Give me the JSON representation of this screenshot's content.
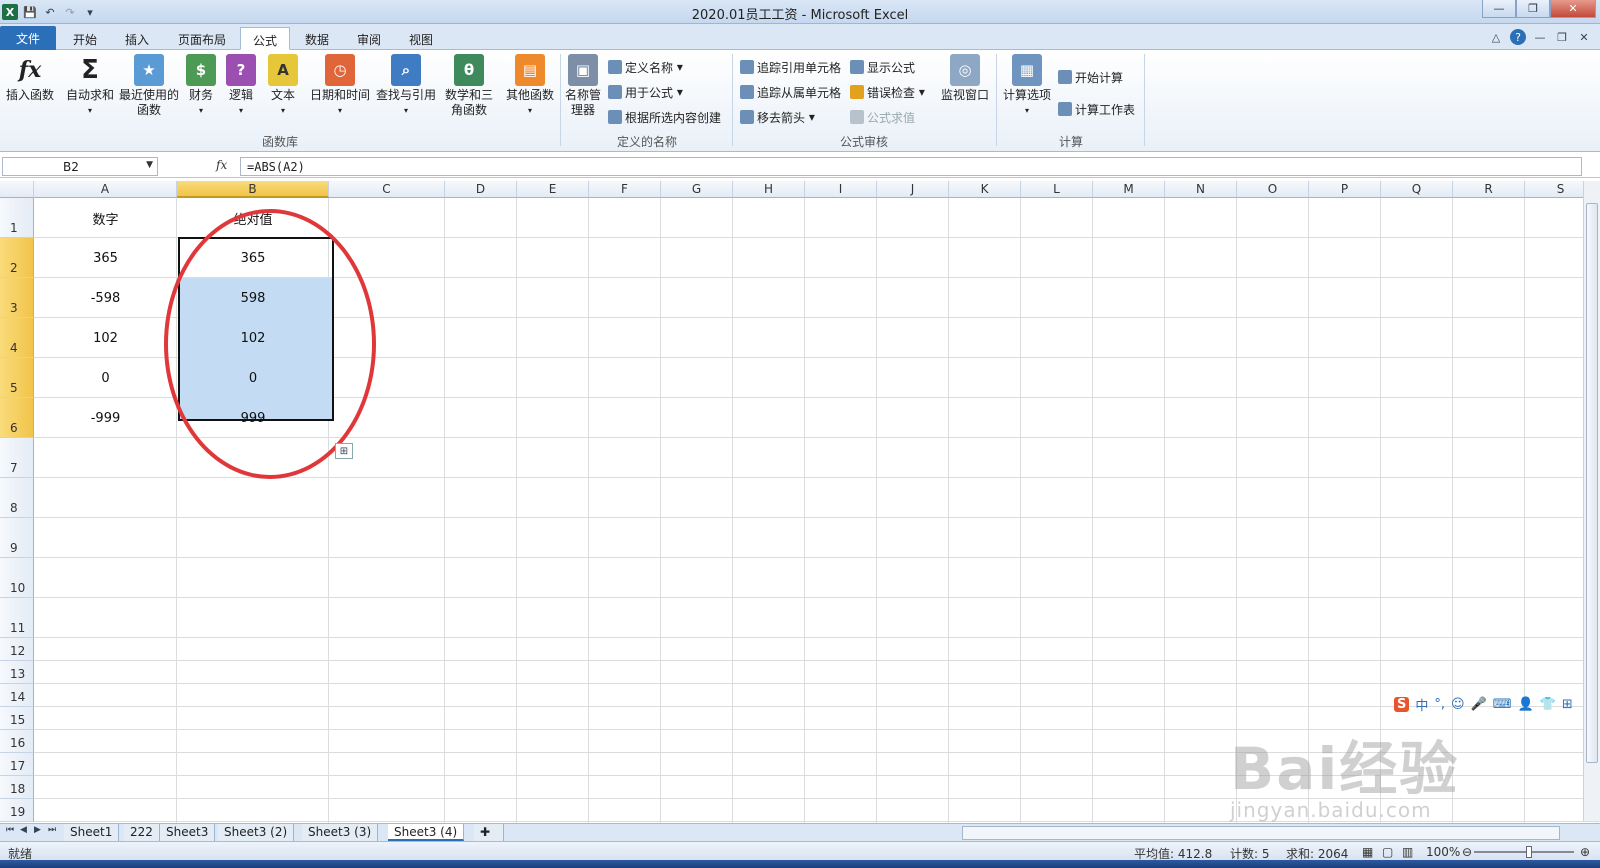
{
  "window": {
    "title": "2020.01员工工资 - Microsoft Excel"
  },
  "tabs": [
    "文件",
    "开始",
    "插入",
    "页面布局",
    "公式",
    "数据",
    "审阅",
    "视图"
  ],
  "ribbon": {
    "function_library": {
      "label": "函数库",
      "buttons": [
        "插入函数",
        "自动求和",
        "最近使用的函数",
        "财务",
        "逻辑",
        "文本",
        "日期和时间",
        "查找与引用",
        "数学和三角函数",
        "其他函数"
      ]
    },
    "defined_names": {
      "label": "定义的名称",
      "manager": "名称管理器",
      "items": [
        "定义名称",
        "用于公式",
        "根据所选内容创建"
      ]
    },
    "formula_auditing": {
      "label": "公式审核",
      "items": [
        "追踪引用单元格",
        "追踪从属单元格",
        "移去箭头",
        "显示公式",
        "错误检查",
        "公式求值"
      ],
      "watch": "监视窗口"
    },
    "calculation": {
      "label": "计算",
      "options": "计算选项",
      "calc_now": "开始计算",
      "calc_sheet": "计算工作表"
    }
  },
  "formula_bar": {
    "name_box": "B2",
    "fx": "fx",
    "formula": "=ABS(A2)"
  },
  "columns": [
    "A",
    "B",
    "C",
    "D",
    "E",
    "F",
    "G",
    "H",
    "I",
    "J",
    "K",
    "L",
    "M",
    "N",
    "O",
    "P",
    "Q",
    "R",
    "S"
  ],
  "rows": [
    "1",
    "2",
    "3",
    "4",
    "5",
    "6",
    "7",
    "8",
    "9",
    "10",
    "11",
    "12",
    "13",
    "14",
    "15",
    "16",
    "17",
    "18",
    "19"
  ],
  "cells": {
    "A1": "数字",
    "B1": "绝对值",
    "A2": "365",
    "B2": "365",
    "A3": "-598",
    "B3": "598",
    "A4": "102",
    "B4": "102",
    "A5": "0",
    "B5": "0",
    "A6": "-999",
    "B6": "999"
  },
  "sheets": [
    "Sheet1",
    "222",
    "Sheet3",
    "Sheet3 (2)",
    "Sheet3 (3)",
    "Sheet3 (4)"
  ],
  "active_sheet": "Sheet3 (4)",
  "status": {
    "ready": "就绪",
    "average": "平均值: 412.8",
    "count": "计数: 5",
    "sum": "求和: 2064",
    "zoom": "100%"
  },
  "ime": [
    "中",
    "°,",
    "☺",
    "🎤",
    "⌨",
    "👤",
    "👕",
    "⊞"
  ],
  "watermark": {
    "line1": "Bai经验",
    "line2": "jingyan.baidu.com"
  }
}
